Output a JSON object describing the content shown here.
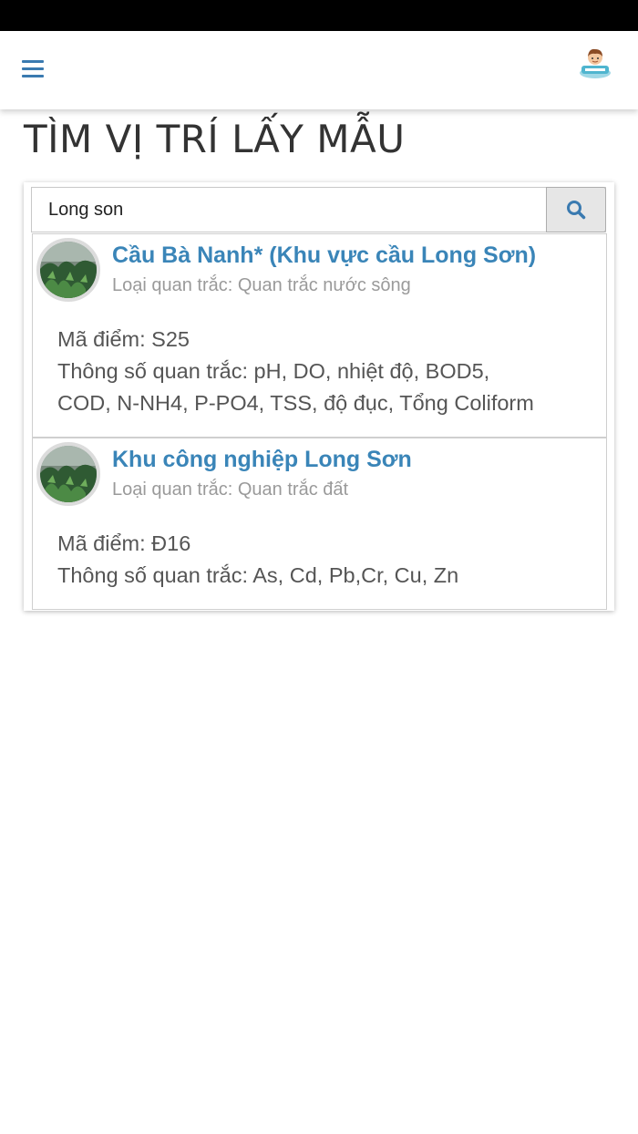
{
  "header": {
    "menu_icon": "hamburger-menu-icon",
    "avatar_icon": "user-avatar-icon"
  },
  "page": {
    "title": "TÌM VỊ TRÍ LẤY MẪU"
  },
  "search": {
    "value": "Long son",
    "button_icon": "search-icon"
  },
  "results": [
    {
      "title": "Cầu Bà Nanh* (Khu vực cầu Long Sơn)",
      "type": "Loại quan trắc: Quan trắc nước sông",
      "code": "Mã điểm: S25",
      "params_line1": "Thông số quan trắc: pH, DO, nhiệt độ, BOD5,",
      "params_line2": "COD, N-NH4, P-PO4, TSS, độ đục, Tổng Coliform"
    },
    {
      "title": "Khu công nghiệp Long Sơn",
      "type": "Loại quan trắc: Quan trắc đất",
      "code": "Mã điểm: Đ16",
      "params_line1": "Thông số quan trắc: As, Cd, Pb,Cr, Cu, Zn"
    }
  ],
  "colors": {
    "accent": "#3a85b8",
    "menu": "#3a7ab0",
    "title": "#333333",
    "muted": "#9a9a9a"
  }
}
